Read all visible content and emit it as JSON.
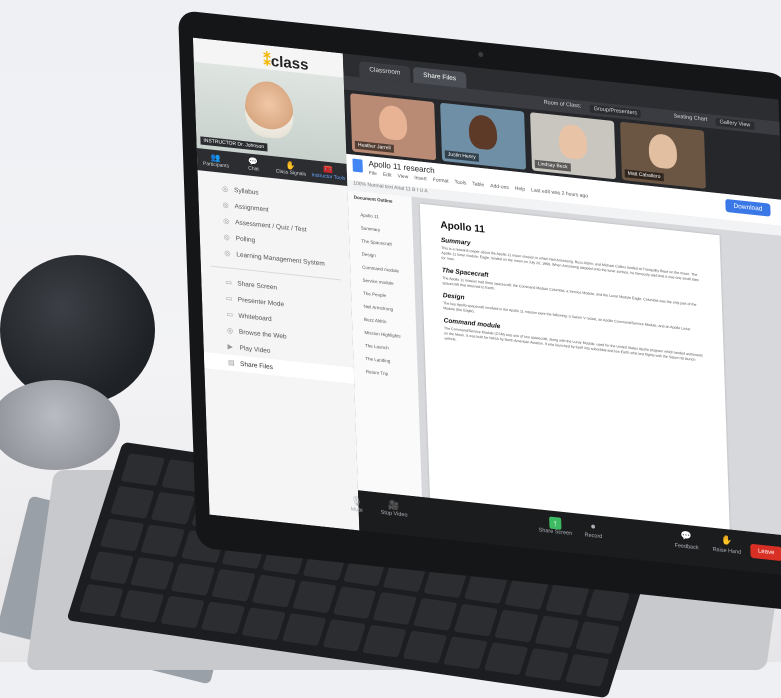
{
  "app": {
    "logo": "class"
  },
  "instructor": {
    "badge": "INSTRUCTOR",
    "name": "Dr. Johnson"
  },
  "tools": [
    {
      "label": "Participants",
      "icon": "participants-icon",
      "glyph": "👥"
    },
    {
      "label": "Chat",
      "icon": "chat-icon",
      "glyph": "💬"
    },
    {
      "label": "Class Signals",
      "icon": "signals-icon",
      "glyph": "✋"
    },
    {
      "label": "Instructor Tools",
      "icon": "tools-icon",
      "glyph": "🧰"
    }
  ],
  "menu": {
    "group1": [
      {
        "label": "Syllabus",
        "glyph": "◎"
      },
      {
        "label": "Assignment",
        "glyph": "◎"
      },
      {
        "label": "Assessment / Quiz / Test",
        "glyph": "◎"
      },
      {
        "label": "Polling",
        "glyph": "◎"
      },
      {
        "label": "Learning Management System",
        "glyph": "◎"
      }
    ],
    "group2": [
      {
        "label": "Share Screen",
        "glyph": "▭"
      },
      {
        "label": "Presenter Mode",
        "glyph": "▭"
      },
      {
        "label": "Whiteboard",
        "glyph": "▭"
      },
      {
        "label": "Browse the Web",
        "glyph": "◎"
      },
      {
        "label": "Play Video",
        "glyph": "▶"
      },
      {
        "label": "Share Files",
        "glyph": "▤"
      }
    ]
  },
  "tabs": [
    "Classroom",
    "Share Files"
  ],
  "toolbar": {
    "room_label": "Room of Class:",
    "room_value": "Group/Presenters",
    "seating_label": "Seating Chart",
    "view_label": "Gallery View"
  },
  "participants": [
    {
      "name": "Heather Jarrell",
      "bg": "#b98a74",
      "skin": "#e7b394"
    },
    {
      "name": "Justin Henry",
      "bg": "#6e8fa6",
      "skin": "#5d3a28"
    },
    {
      "name": "Lindsay Beck",
      "bg": "#c9c6c0",
      "skin": "#e9c3a6"
    },
    {
      "name": "Matt Cabaltero",
      "bg": "#6b5644",
      "skin": "#e2bfa0"
    }
  ],
  "doc": {
    "title": "Apollo 11 research",
    "menus": [
      "File",
      "Edit",
      "View",
      "Insert",
      "Format",
      "Tools",
      "Table",
      "Add-ons",
      "Help",
      "Last edit was 2 hours ago"
    ],
    "download": "Download",
    "format_bar": "100%   Normal text   Arial   11   B  I  U  A",
    "outline_title": "Document Outline",
    "outline": [
      "Apollo 11",
      "Summary",
      "The Spacecraft",
      "Design",
      "Command module",
      "Service module",
      "The People",
      "Neil Armstrong",
      "Buzz Aldrin",
      "Mission Highlights",
      "The Launch",
      "The Landing",
      "Return Trip"
    ],
    "heading": "Apollo 11",
    "sections": [
      {
        "h": "Summary",
        "p": "This is a research paper about the Apollo 11 moon mission in which Neil Armstrong, Buzz Aldrin, and Michael Collins landed at Tranquility Base on the moon. The Apollo 11 lunar module, Eagle, landed on the moon on July 20, 1969. When Armstrong stepped onto the lunar surface, he famously said that it was one small step for man."
      },
      {
        "h": "The Spacecraft",
        "p": "The Apollo 11 mission had three spacecraft: the Command Module Columbia, a Service Module, and the Lunar Module Eagle. Columbia was the only part of the spacecraft that returned to Earth."
      },
      {
        "h": "Design",
        "p": "The key Apollo spacecraft involved in the Apollo 11 mission were the following: a Saturn V rocket, an Apollo Command/Service Module, and an Apollo Lunar Module (the Eagle)."
      },
      {
        "h": "Command module",
        "p": "The Command/Service Module (CSM) was one of two spacecraft, along with the Lunar Module, used for the United States Apollo program which landed astronauts on the Moon. It was built for NASA by North American Aviation. It was launched by itself into suborbital and low Earth orbit test flights with the Saturn IB launch vehicle."
      }
    ]
  },
  "controls": {
    "mute": "Mute",
    "stop_video": "Stop Video",
    "share_screen": "Share Screen",
    "record": "Record",
    "feedback": "Feedback",
    "raise_hand": "Raise Hand",
    "leave": "Leave"
  },
  "colors": {
    "accent": "#3b78e7",
    "leave": "#d93025",
    "share": "#3dbb63"
  }
}
